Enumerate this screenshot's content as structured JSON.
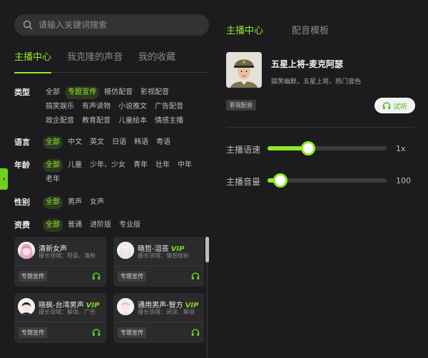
{
  "search": {
    "placeholder": "请输入关键词搜索"
  },
  "left_tabs": [
    {
      "label": "主播中心",
      "active": true
    },
    {
      "label": "我克隆的声音",
      "active": false
    },
    {
      "label": "我的收藏",
      "active": false
    }
  ],
  "filters": {
    "type": {
      "label": "类型",
      "options": [
        "全部",
        "专题宣传",
        "模仿配音",
        "影视配音",
        "搞笑娱乐",
        "有声读物",
        "小说推文",
        "广告配音",
        "政企配音",
        "教育配音",
        "儿童绘本",
        "情感主播"
      ],
      "selected": "专题宣传"
    },
    "language": {
      "label": "语言",
      "options": [
        "全部",
        "中文",
        "英文",
        "日语",
        "韩语",
        "粤语"
      ],
      "selected": "全部"
    },
    "age": {
      "label": "年龄",
      "options": [
        "全部",
        "儿童",
        "少年、少女",
        "青年",
        "壮年",
        "中年",
        "老年"
      ],
      "selected": "全部"
    },
    "gender": {
      "label": "性别",
      "options": [
        "全部",
        "男声",
        "女声"
      ],
      "selected": "全部"
    },
    "level": {
      "label": "资费",
      "options": [
        "全部",
        "普通",
        "进阶版",
        "专业版"
      ],
      "selected": "全部"
    }
  },
  "cards": [
    {
      "name": "清新女声",
      "vip": "",
      "desc": "擅长领域：轻盈、清新",
      "tag": "专题宣传",
      "avatar": "anime-girl-pink-hair"
    },
    {
      "name": "晓哲-沮丧",
      "vip": "VIP",
      "desc": "擅长领域：情感挫折",
      "tag": "专题宣传",
      "avatar": "anime-boy-white-hair"
    },
    {
      "name": "晓枫-台湾男声",
      "vip": "VIP",
      "desc": "擅长领域：解说、广告",
      "tag": "专题宣传",
      "avatar": "anime-boy-black-hair"
    },
    {
      "name": "通用男声-智方",
      "vip": "VIP",
      "desc": "擅长领域：阅读、解说",
      "tag": "专题宣传",
      "avatar": "anime-boy-pink-hair"
    }
  ],
  "right_tabs": [
    {
      "label": "主播中心",
      "active": true
    },
    {
      "label": "配音模板",
      "active": false
    }
  ],
  "anchor": {
    "name": "五星上将-麦克阿瑟",
    "desc": "搞笑幽默，五星上将，热门音色",
    "tag": "影视配音",
    "listen_label": "试听",
    "avatar": "general-portrait"
  },
  "speed": {
    "label": "主播语速",
    "value_text": "1x",
    "fraction": 0.34
  },
  "volume": {
    "label": "主播音量",
    "value_text": "100",
    "fraction": 0.11
  },
  "colors": {
    "accent": "#8fe82a",
    "background": "#1c1c1e",
    "panel": "#2b2b2d"
  }
}
